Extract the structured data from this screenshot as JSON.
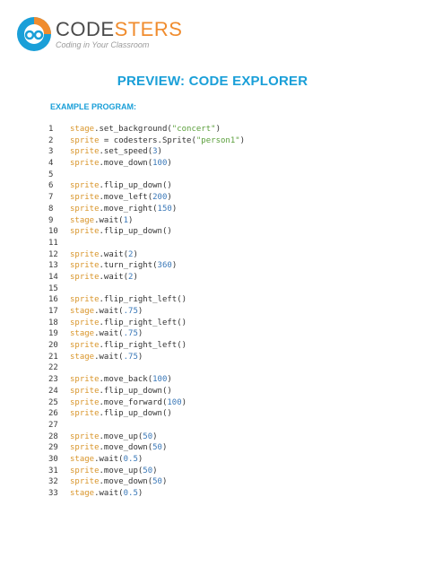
{
  "header": {
    "brand_prefix": "CODE",
    "brand_suffix": "STERS",
    "tagline": "Coding in Your Classroom"
  },
  "title": "PREVIEW: CODE EXPLORER",
  "section_label": "EXAMPLE PROGRAM:",
  "colors": {
    "accent": "#1a9fd8",
    "brand_orange": "#f08c2e",
    "object": "#d9952a",
    "string": "#5a9e3a",
    "number": "#3a78b8"
  },
  "code_lines": [
    [
      {
        "t": "stage",
        "c": "obj"
      },
      {
        "t": ".set_background(",
        "c": "plain"
      },
      {
        "t": "\"concert\"",
        "c": "str"
      },
      {
        "t": ")",
        "c": "plain"
      }
    ],
    [
      {
        "t": "sprite",
        "c": "obj"
      },
      {
        "t": " = codesters.Sprite(",
        "c": "plain"
      },
      {
        "t": "\"person1\"",
        "c": "str"
      },
      {
        "t": ")",
        "c": "plain"
      }
    ],
    [
      {
        "t": "sprite",
        "c": "obj"
      },
      {
        "t": ".set_speed(",
        "c": "plain"
      },
      {
        "t": "3",
        "c": "num"
      },
      {
        "t": ")",
        "c": "plain"
      }
    ],
    [
      {
        "t": "sprite",
        "c": "obj"
      },
      {
        "t": ".move_down(",
        "c": "plain"
      },
      {
        "t": "100",
        "c": "num"
      },
      {
        "t": ")",
        "c": "plain"
      }
    ],
    [],
    [
      {
        "t": "sprite",
        "c": "obj"
      },
      {
        "t": ".flip_up_down()",
        "c": "plain"
      }
    ],
    [
      {
        "t": "sprite",
        "c": "obj"
      },
      {
        "t": ".move_left(",
        "c": "plain"
      },
      {
        "t": "200",
        "c": "num"
      },
      {
        "t": ")",
        "c": "plain"
      }
    ],
    [
      {
        "t": "sprite",
        "c": "obj"
      },
      {
        "t": ".move_right(",
        "c": "plain"
      },
      {
        "t": "150",
        "c": "num"
      },
      {
        "t": ")",
        "c": "plain"
      }
    ],
    [
      {
        "t": "stage",
        "c": "obj"
      },
      {
        "t": ".wait(",
        "c": "plain"
      },
      {
        "t": "1",
        "c": "num"
      },
      {
        "t": ")",
        "c": "plain"
      }
    ],
    [
      {
        "t": "sprite",
        "c": "obj"
      },
      {
        "t": ".flip_up_down()",
        "c": "plain"
      }
    ],
    [],
    [
      {
        "t": "sprite",
        "c": "obj"
      },
      {
        "t": ".wait(",
        "c": "plain"
      },
      {
        "t": "2",
        "c": "num"
      },
      {
        "t": ")",
        "c": "plain"
      }
    ],
    [
      {
        "t": "sprite",
        "c": "obj"
      },
      {
        "t": ".turn_right(",
        "c": "plain"
      },
      {
        "t": "360",
        "c": "num"
      },
      {
        "t": ")",
        "c": "plain"
      }
    ],
    [
      {
        "t": "sprite",
        "c": "obj"
      },
      {
        "t": ".wait(",
        "c": "plain"
      },
      {
        "t": "2",
        "c": "num"
      },
      {
        "t": ")",
        "c": "plain"
      }
    ],
    [],
    [
      {
        "t": "sprite",
        "c": "obj"
      },
      {
        "t": ".flip_right_left()",
        "c": "plain"
      }
    ],
    [
      {
        "t": "stage",
        "c": "obj"
      },
      {
        "t": ".wait(",
        "c": "plain"
      },
      {
        "t": ".75",
        "c": "num"
      },
      {
        "t": ")",
        "c": "plain"
      }
    ],
    [
      {
        "t": "sprite",
        "c": "obj"
      },
      {
        "t": ".flip_right_left()",
        "c": "plain"
      }
    ],
    [
      {
        "t": "stage",
        "c": "obj"
      },
      {
        "t": ".wait(",
        "c": "plain"
      },
      {
        "t": ".75",
        "c": "num"
      },
      {
        "t": ")",
        "c": "plain"
      }
    ],
    [
      {
        "t": "sprite",
        "c": "obj"
      },
      {
        "t": ".flip_right_left()",
        "c": "plain"
      }
    ],
    [
      {
        "t": "stage",
        "c": "obj"
      },
      {
        "t": ".wait(",
        "c": "plain"
      },
      {
        "t": ".75",
        "c": "num"
      },
      {
        "t": ")",
        "c": "plain"
      }
    ],
    [],
    [
      {
        "t": "sprite",
        "c": "obj"
      },
      {
        "t": ".move_back(",
        "c": "plain"
      },
      {
        "t": "100",
        "c": "num"
      },
      {
        "t": ")",
        "c": "plain"
      }
    ],
    [
      {
        "t": "sprite",
        "c": "obj"
      },
      {
        "t": ".flip_up_down()",
        "c": "plain"
      }
    ],
    [
      {
        "t": "sprite",
        "c": "obj"
      },
      {
        "t": ".move_forward(",
        "c": "plain"
      },
      {
        "t": "100",
        "c": "num"
      },
      {
        "t": ")",
        "c": "plain"
      }
    ],
    [
      {
        "t": "sprite",
        "c": "obj"
      },
      {
        "t": ".flip_up_down()",
        "c": "plain"
      }
    ],
    [],
    [
      {
        "t": "sprite",
        "c": "obj"
      },
      {
        "t": ".move_up(",
        "c": "plain"
      },
      {
        "t": "50",
        "c": "num"
      },
      {
        "t": ")",
        "c": "plain"
      }
    ],
    [
      {
        "t": "sprite",
        "c": "obj"
      },
      {
        "t": ".move_down(",
        "c": "plain"
      },
      {
        "t": "50",
        "c": "num"
      },
      {
        "t": ")",
        "c": "plain"
      }
    ],
    [
      {
        "t": "stage",
        "c": "obj"
      },
      {
        "t": ".wait(",
        "c": "plain"
      },
      {
        "t": "0.5",
        "c": "num"
      },
      {
        "t": ")",
        "c": "plain"
      }
    ],
    [
      {
        "t": "sprite",
        "c": "obj"
      },
      {
        "t": ".move_up(",
        "c": "plain"
      },
      {
        "t": "50",
        "c": "num"
      },
      {
        "t": ")",
        "c": "plain"
      }
    ],
    [
      {
        "t": "sprite",
        "c": "obj"
      },
      {
        "t": ".move_down(",
        "c": "plain"
      },
      {
        "t": "50",
        "c": "num"
      },
      {
        "t": ")",
        "c": "plain"
      }
    ],
    [
      {
        "t": "stage",
        "c": "obj"
      },
      {
        "t": ".wait(",
        "c": "plain"
      },
      {
        "t": "0.5",
        "c": "num"
      },
      {
        "t": ")",
        "c": "plain"
      }
    ]
  ]
}
